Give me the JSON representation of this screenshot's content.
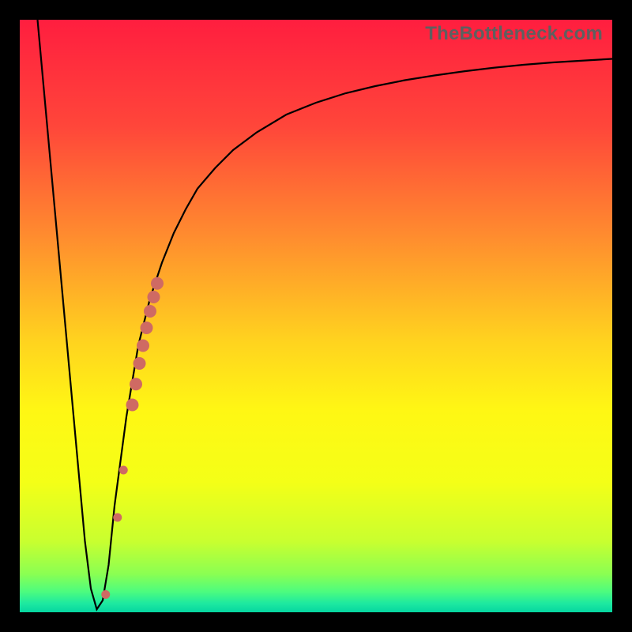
{
  "watermark": "TheBottleneck.com",
  "colors": {
    "frame": "#000000",
    "curve_stroke": "#000000",
    "marker_fill": "#cf6a63",
    "gradient_stops": [
      {
        "offset": 0.0,
        "color": "#ff1e3f"
      },
      {
        "offset": 0.18,
        "color": "#ff463a"
      },
      {
        "offset": 0.36,
        "color": "#ff8a2f"
      },
      {
        "offset": 0.54,
        "color": "#ffd21f"
      },
      {
        "offset": 0.66,
        "color": "#fff714"
      },
      {
        "offset": 0.78,
        "color": "#f4ff17"
      },
      {
        "offset": 0.88,
        "color": "#c9ff2f"
      },
      {
        "offset": 0.935,
        "color": "#8bff52"
      },
      {
        "offset": 0.965,
        "color": "#4dfc7e"
      },
      {
        "offset": 0.985,
        "color": "#1de9a0"
      },
      {
        "offset": 1.0,
        "color": "#06d6a0"
      }
    ]
  },
  "chart_data": {
    "type": "line",
    "title": "",
    "xlabel": "",
    "ylabel": "",
    "xlim": [
      0,
      100
    ],
    "ylim": [
      0,
      100
    ],
    "series": [
      {
        "name": "curve",
        "x": [
          3,
          5,
          7,
          9,
          11,
          12,
          13,
          14,
          15,
          16,
          18,
          20,
          22,
          24,
          26,
          28,
          30,
          33,
          36,
          40,
          45,
          50,
          55,
          60,
          65,
          70,
          75,
          80,
          85,
          90,
          95,
          100
        ],
        "y": [
          100,
          78,
          56,
          34,
          12,
          4,
          0.5,
          2,
          8,
          18,
          33,
          45,
          53,
          59,
          64,
          68,
          71.5,
          75,
          78,
          81,
          84,
          86,
          87.6,
          88.8,
          89.8,
          90.6,
          91.3,
          91.9,
          92.4,
          92.8,
          93.1,
          93.4
        ]
      }
    ],
    "markers": [
      {
        "x": 14.5,
        "y": 3.0,
        "r": 5.5
      },
      {
        "x": 16.5,
        "y": 16.0,
        "r": 5.5
      },
      {
        "x": 17.5,
        "y": 24.0,
        "r": 5.5
      },
      {
        "x": 19.0,
        "y": 35.0,
        "r": 8.0
      },
      {
        "x": 19.6,
        "y": 38.5,
        "r": 8.0
      },
      {
        "x": 20.2,
        "y": 42.0,
        "r": 8.0
      },
      {
        "x": 20.8,
        "y": 45.0,
        "r": 8.0
      },
      {
        "x": 21.4,
        "y": 48.0,
        "r": 8.0
      },
      {
        "x": 22.0,
        "y": 50.8,
        "r": 8.0
      },
      {
        "x": 22.6,
        "y": 53.2,
        "r": 8.0
      },
      {
        "x": 23.2,
        "y": 55.5,
        "r": 8.0
      }
    ]
  }
}
